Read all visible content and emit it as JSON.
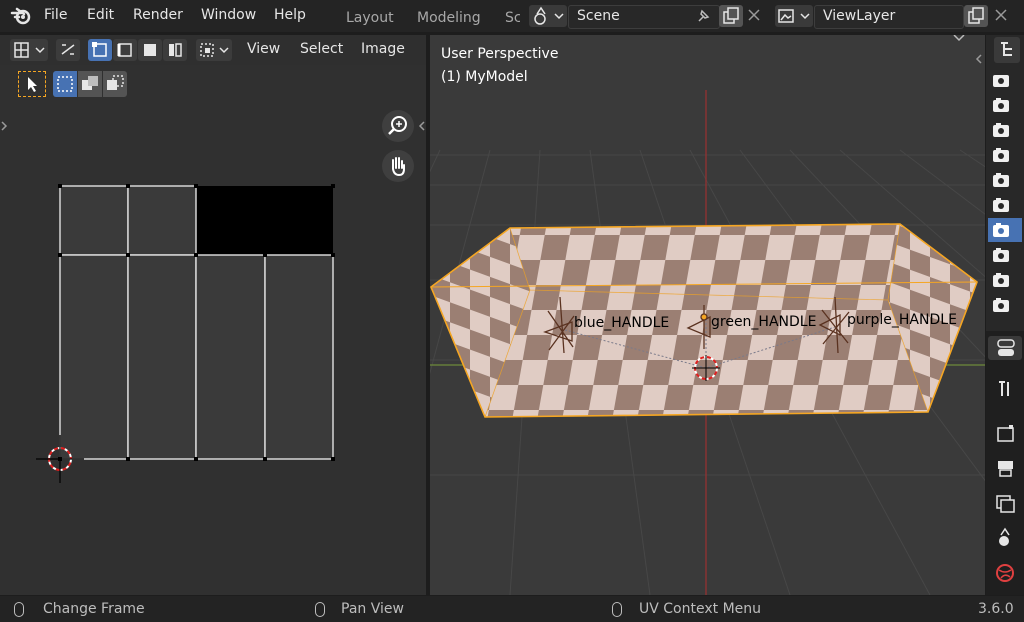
{
  "menubar": {
    "items": [
      "File",
      "Edit",
      "Render",
      "Window",
      "Help"
    ],
    "workspace_tabs": [
      "Layout",
      "Modeling",
      "Sc"
    ]
  },
  "scene_selector": {
    "value": "Scene"
  },
  "viewlayer_selector": {
    "value": "ViewLayer"
  },
  "uv_editor": {
    "menus": [
      "View",
      "Select",
      "Image"
    ]
  },
  "viewport": {
    "perspective_label": "User Perspective",
    "object_label": "(1) MyModel",
    "handles": [
      "blue_HANDLE",
      "green_HANDLE",
      "purple_HANDLE"
    ]
  },
  "properties": {
    "tabs": [
      "render-tab",
      "output-tab",
      "view-layer-tab",
      "scene-tab",
      "world-tab"
    ]
  },
  "statusbar": {
    "left": "Change Frame",
    "middle": "Pan View",
    "right": "UV Context Menu",
    "version": "3.6.0"
  },
  "colors": {
    "accent": "#4772b3",
    "selection_orange": "#f5a623",
    "checker_dark": "#9b7f73",
    "checker_light": "#e0ccc4"
  }
}
